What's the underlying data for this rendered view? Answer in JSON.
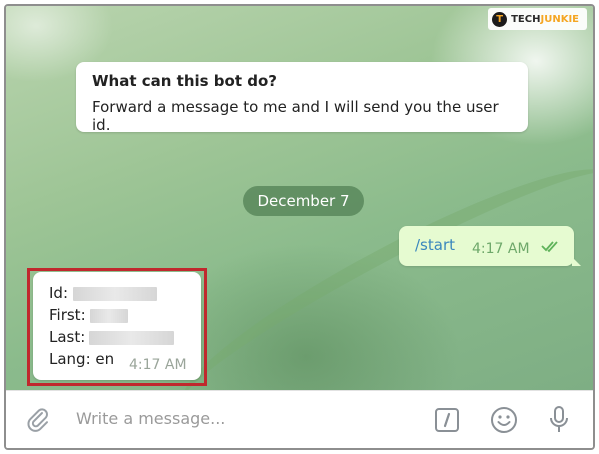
{
  "watermark": {
    "logo": "T",
    "brand_prefix": "TECH",
    "brand_suffix": "JUNKIE"
  },
  "bot_info": {
    "title": "What can this bot do?",
    "body": "Forward a message to me and I will send you the user id."
  },
  "date_separator": "December 7",
  "outgoing": {
    "text": "/start",
    "time": "4:17 AM",
    "status_icon": "double-check-icon"
  },
  "incoming": {
    "lines": [
      {
        "label": "Id:",
        "value_redacted": true
      },
      {
        "label": "First:",
        "value_redacted": true
      },
      {
        "label": "Last:",
        "value_redacted": true
      },
      {
        "label": "Lang: en"
      }
    ],
    "time": "4:17 AM",
    "highlight_color": "#c0282d"
  },
  "composer": {
    "placeholder": "Write a message...",
    "icons": [
      "paperclip-icon",
      "slash-command-icon",
      "emoji-icon",
      "microphone-icon"
    ]
  },
  "colors": {
    "outgoing_bubble": "#e6fbd1",
    "accent_link": "#3a87bd",
    "time_green": "#6ea86a"
  }
}
